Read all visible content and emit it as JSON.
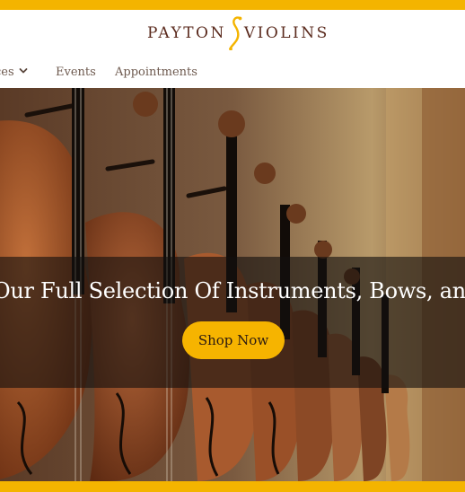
{
  "brand": {
    "name_left": "PAYTON",
    "name_right": "VIOLINS",
    "accent": "#f4b400",
    "text_color": "#5a2a1d"
  },
  "nav": {
    "services_label": "ces",
    "services_icon": "chevron-down-icon",
    "events_label": "Events",
    "appointments_label": "Appointments"
  },
  "hero": {
    "image": "violins-hanging-on-wall",
    "headline": "Our Full Selection Of Instruments, Bows, and",
    "cta_label": "Shop Now",
    "cta_color": "#f6b400"
  }
}
